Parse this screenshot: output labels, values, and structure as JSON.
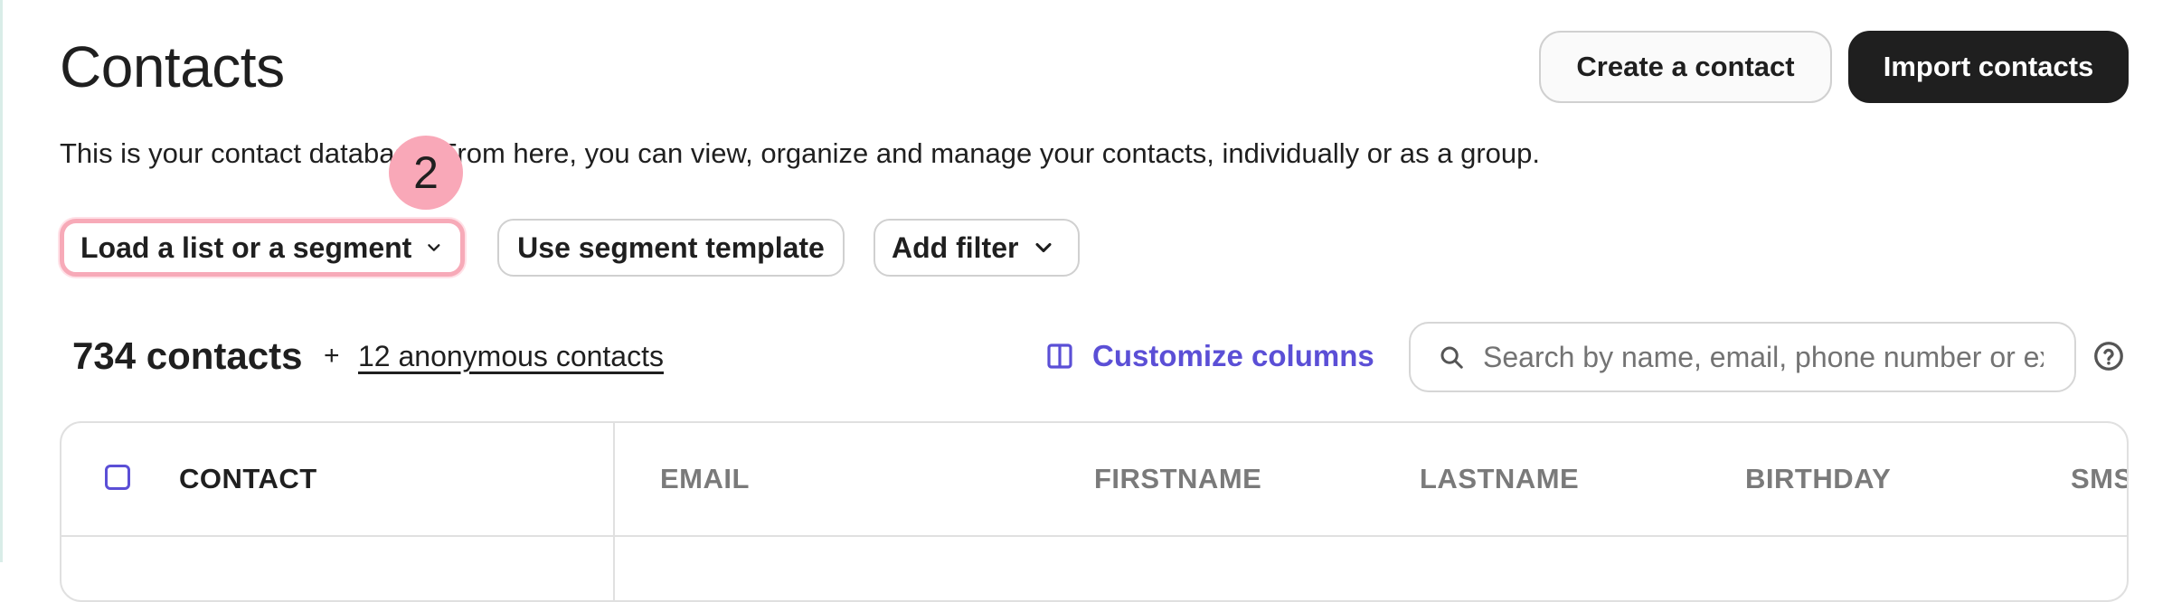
{
  "page": {
    "title": "Contacts",
    "description": "This is your contact database. From here, you can view, organize and manage your contacts, individually or as a group."
  },
  "header_actions": {
    "create_contact": "Create a contact",
    "import_contacts": "Import contacts"
  },
  "filters": {
    "load_segment": "Load a list or a segment",
    "segment_template": "Use segment template",
    "add_filter": "Add filter"
  },
  "step_badge": "2",
  "summary": {
    "contacts_count": "734 contacts",
    "plus": "+",
    "anonymous_link": "12 anonymous contacts"
  },
  "customize_columns": "Customize columns",
  "search": {
    "placeholder": "Search by name, email, phone number or ext. ID"
  },
  "table": {
    "columns": [
      "CONTACT",
      "EMAIL",
      "FIRSTNAME",
      "LASTNAME",
      "BIRTHDAY",
      "SMS"
    ]
  },
  "colors": {
    "accent": "#5b4fd6",
    "highlight": "#f9a8b8",
    "dark_button": "#1f1f1f"
  }
}
